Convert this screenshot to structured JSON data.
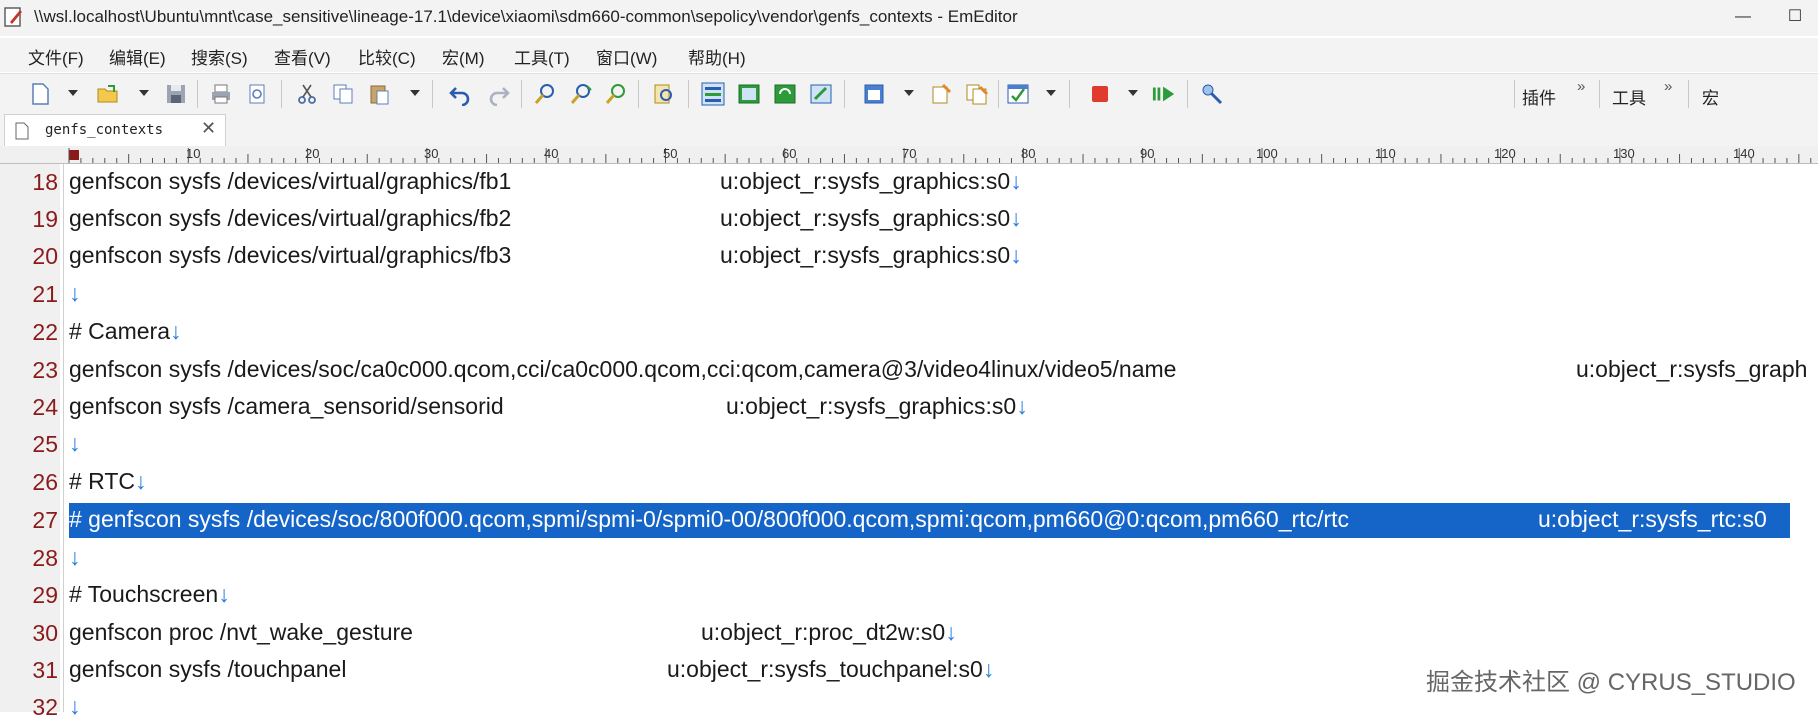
{
  "window": {
    "title": "\\\\wsl.localhost\\Ubuntu\\mnt\\case_sensitive\\lineage-17.1\\device\\xiaomi\\sdm660-common\\sepolicy\\vendor\\genfs_contexts - EmEditor",
    "minimize": "—",
    "maximize": "☐"
  },
  "menu": [
    "文件(F)",
    "编辑(E)",
    "搜索(S)",
    "查看(V)",
    "比较(C)",
    "宏(M)",
    "工具(T)",
    "窗口(W)",
    "帮助(H)"
  ],
  "toolbar": {
    "plugins": "插件",
    "tools": "工具",
    "macro": "宏",
    "chevron": "»"
  },
  "tab": {
    "label": "genfs_contexts",
    "close": "✕"
  },
  "ruler": [
    "10",
    "20",
    "30",
    "40",
    "50",
    "60",
    "70",
    "80",
    "90",
    "100",
    "110",
    "120",
    "130",
    "140"
  ],
  "newline_marker": "↓",
  "lines": [
    {
      "num": "18",
      "text": "genfscon sysfs /devices/virtual/graphics/fb1",
      "context": "u:object_r:sysfs_graphics:s0",
      "nl": true
    },
    {
      "num": "19",
      "text": "genfscon sysfs /devices/virtual/graphics/fb2",
      "context": "u:object_r:sysfs_graphics:s0",
      "nl": true
    },
    {
      "num": "20",
      "text": "genfscon sysfs /devices/virtual/graphics/fb3",
      "context": "u:object_r:sysfs_graphics:s0",
      "nl": true
    },
    {
      "num": "21",
      "text": "",
      "context": "",
      "nl": true
    },
    {
      "num": "22",
      "text": "# Camera",
      "context": "",
      "nl": true
    },
    {
      "num": "23",
      "text": "genfscon sysfs /devices/soc/ca0c000.qcom,cci/ca0c000.qcom,cci:qcom,camera@3/video4linux/video5/name",
      "context": "u:object_r:sysfs_graph",
      "nl": false
    },
    {
      "num": "24",
      "text": "genfscon sysfs /camera_sensorid/sensorid",
      "context": "u:object_r:sysfs_graphics:s0",
      "nl": true
    },
    {
      "num": "25",
      "text": "",
      "context": "",
      "nl": true
    },
    {
      "num": "26",
      "text": "# RTC",
      "context": "",
      "nl": true
    },
    {
      "num": "27",
      "text": "# genfscon sysfs /devices/soc/800f000.qcom,spmi/spmi-0/spmi0-00/800f000.qcom,spmi:qcom,pm660@0:qcom,pm660_rtc/rtc",
      "context": "u:object_r:sysfs_rtc:s0",
      "nl": false,
      "selected": true
    },
    {
      "num": "28",
      "text": "",
      "context": "",
      "nl": true
    },
    {
      "num": "29",
      "text": "# Touchscreen",
      "context": "",
      "nl": true
    },
    {
      "num": "30",
      "text": "genfscon proc /nvt_wake_gesture",
      "context": "u:object_r:proc_dt2w:s0",
      "nl": true
    },
    {
      "num": "31",
      "text": "genfscon sysfs /touchpanel",
      "context": "u:object_r:sysfs_touchpanel:s0",
      "nl": true
    },
    {
      "num": "32",
      "text": "",
      "context": "",
      "nl": true
    }
  ],
  "watermark": "掘金技术社区 @ CYRUS_STUDIO",
  "colors": {
    "selection": "#1565c8",
    "line_number": "#8b1a1a",
    "newline_marker": "#2a7de1"
  }
}
